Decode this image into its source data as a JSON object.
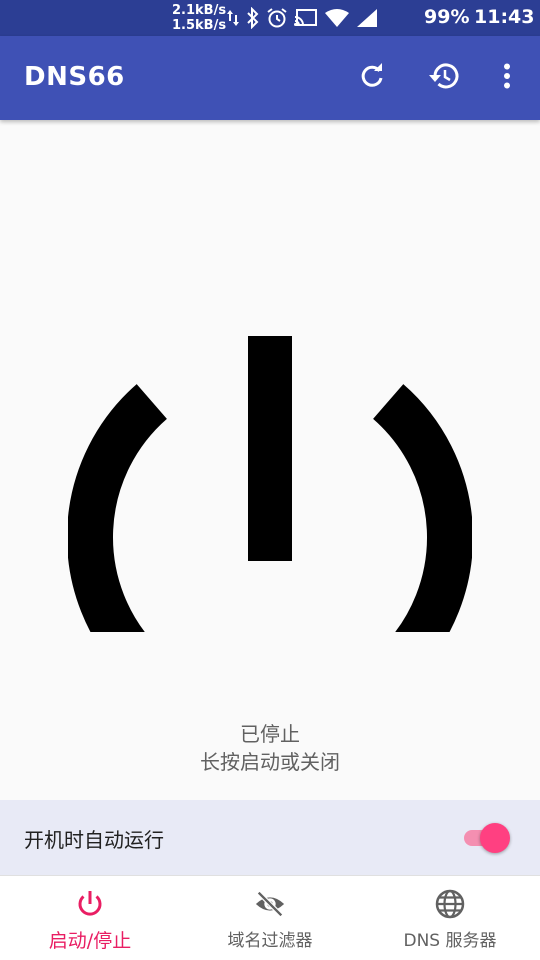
{
  "status_bar": {
    "upload_speed": "2.1kB/s",
    "download_speed": "1.5kB/s",
    "battery": "99%",
    "time": "11:43",
    "icons": [
      "data-arrows-icon",
      "bluetooth-icon",
      "alarm-icon",
      "cast-icon",
      "wifi-icon",
      "signal-icon"
    ]
  },
  "app_bar": {
    "title": "DNS66",
    "actions": [
      "refresh-icon",
      "history-icon",
      "more-vert-icon"
    ],
    "color": "#3f51b5"
  },
  "main": {
    "power_state": "stopped",
    "status_line1": "已停止",
    "status_line2": "长按启动或关闭"
  },
  "autostart": {
    "label": "开机时自动运行",
    "enabled": true,
    "accent": "#ff4081"
  },
  "bottom_nav": {
    "items": [
      {
        "label": "启动/停止",
        "icon": "power-icon",
        "active": true
      },
      {
        "label": "域名过滤器",
        "icon": "eye-off-icon",
        "active": false
      },
      {
        "label": "DNS 服务器",
        "icon": "globe-icon",
        "active": false
      }
    ],
    "active_color": "#e91e63"
  }
}
